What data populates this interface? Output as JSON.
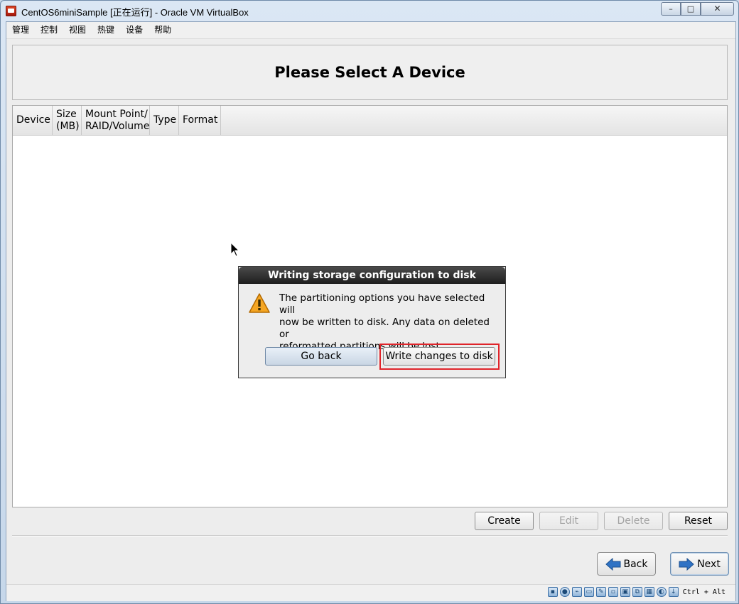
{
  "window": {
    "title": "CentOS6miniSample [正在运行] - Oracle VM VirtualBox",
    "min_glyph": "–",
    "max_glyph": "□",
    "close_glyph": "✕"
  },
  "menu": [
    "管理",
    "控制",
    "视图",
    "热键",
    "设备",
    "帮助"
  ],
  "page": {
    "title": "Please Select A Device"
  },
  "table": {
    "columns": [
      "Device",
      "Size\n(MB)",
      "Mount Point/\nRAID/Volume",
      "Type",
      "Format"
    ]
  },
  "partition_buttons": {
    "create": "Create",
    "edit": "Edit",
    "delete": "Delete",
    "reset": "Reset"
  },
  "nav": {
    "back": "Back",
    "next": "Next"
  },
  "dialog": {
    "title": "Writing storage configuration to disk",
    "message": "The partitioning options you have selected will\nnow be written to disk.  Any data on deleted or\nreformatted partitions will be lost.",
    "go_back": "Go back",
    "write": "Write changes to disk",
    "icon": "warning-icon"
  },
  "statusbar": {
    "host_key": "Ctrl + Alt",
    "icons": [
      "hard-disk-icon",
      "optical-drive-icon",
      "usb-icon",
      "shared-folders-icon",
      "pencil-icon",
      "display-icon",
      "screen-icon",
      "network-icon",
      "video-capture-icon",
      "mouse-integration-icon",
      "keyboard-capture-icon"
    ]
  },
  "colors": {
    "highlight": "#e0242a",
    "dialog_title_bg": "#2a2a2a",
    "accent_arrow": "#2f72c4"
  }
}
